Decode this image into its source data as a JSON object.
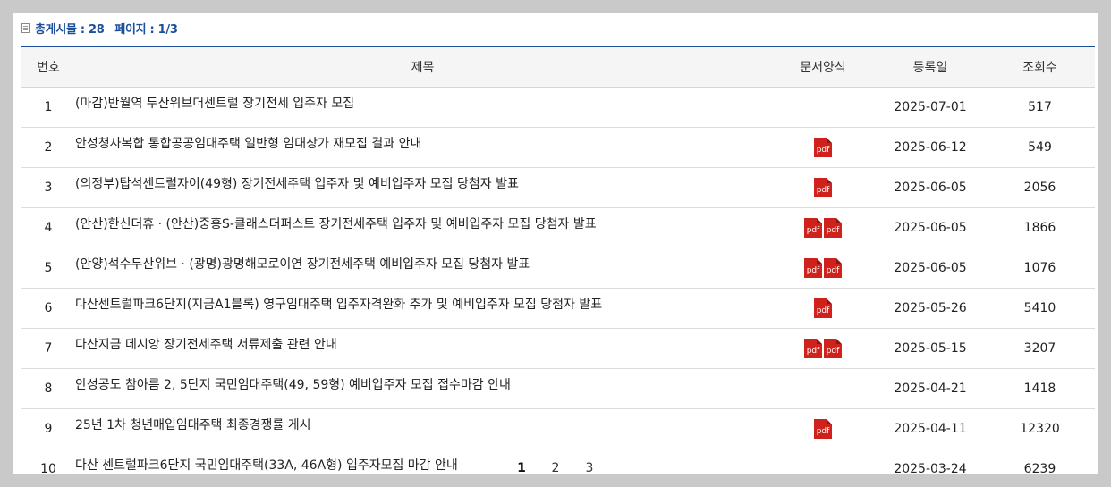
{
  "summary": {
    "total_label": "총게시물 : 28",
    "page_label": "페이지 : 1/3"
  },
  "table": {
    "headers": [
      "번호",
      "제목",
      "문서양식",
      "등록일",
      "조회수"
    ],
    "pdf_label": "pdf",
    "rows": [
      {
        "no": "1",
        "title": "(마감)반월역 두산위브더센트럴 장기전세 입주자 모집",
        "pdf_count": 0,
        "date": "2025-07-01",
        "views": "517"
      },
      {
        "no": "2",
        "title": "안성청사복합 통합공공임대주택 일반형 임대상가 재모집 결과 안내",
        "pdf_count": 1,
        "date": "2025-06-12",
        "views": "549"
      },
      {
        "no": "3",
        "title": "(의정부)탑석센트럴자이(49형) 장기전세주택 입주자 및 예비입주자 모집 당첨자 발표",
        "pdf_count": 1,
        "date": "2025-06-05",
        "views": "2056"
      },
      {
        "no": "4",
        "title": "(안산)한신더휴 · (안산)중흥S-클래스더퍼스트 장기전세주택 입주자 및 예비입주자 모집 당첨자 발표",
        "pdf_count": 2,
        "date": "2025-06-05",
        "views": "1866"
      },
      {
        "no": "5",
        "title": "(안양)석수두산위브 · (광명)광명해모로이연 장기전세주택 예비입주자 모집 당첨자 발표",
        "pdf_count": 2,
        "date": "2025-06-05",
        "views": "1076"
      },
      {
        "no": "6",
        "title": "다산센트럴파크6단지(지금A1블록) 영구임대주택 입주자격완화 추가 및 예비입주자 모집 당첨자 발표",
        "pdf_count": 1,
        "date": "2025-05-26",
        "views": "5410"
      },
      {
        "no": "7",
        "title": "다산지금 데시앙 장기전세주택 서류제출 관련 안내",
        "pdf_count": 2,
        "date": "2025-05-15",
        "views": "3207"
      },
      {
        "no": "8",
        "title": "안성공도 참아름 2, 5단지 국민임대주택(49, 59형) 예비입주자 모집 접수마감 안내",
        "pdf_count": 0,
        "date": "2025-04-21",
        "views": "1418"
      },
      {
        "no": "9",
        "title": "25년 1차 청년매입임대주택 최종경쟁률 게시",
        "pdf_count": 1,
        "date": "2025-04-11",
        "views": "12320"
      },
      {
        "no": "10",
        "title": "다산 센트럴파크6단지 국민임대주택(33A, 46A형) 입주자모집 마감 안내",
        "pdf_count": 0,
        "date": "2025-03-24",
        "views": "6239"
      }
    ]
  },
  "pagination": {
    "pages": [
      "1",
      "2",
      "3"
    ],
    "current": "1"
  },
  "colors": {
    "accent": "#1b4f9c",
    "pdf": "#d0221c",
    "background": "#c9c9c9"
  }
}
